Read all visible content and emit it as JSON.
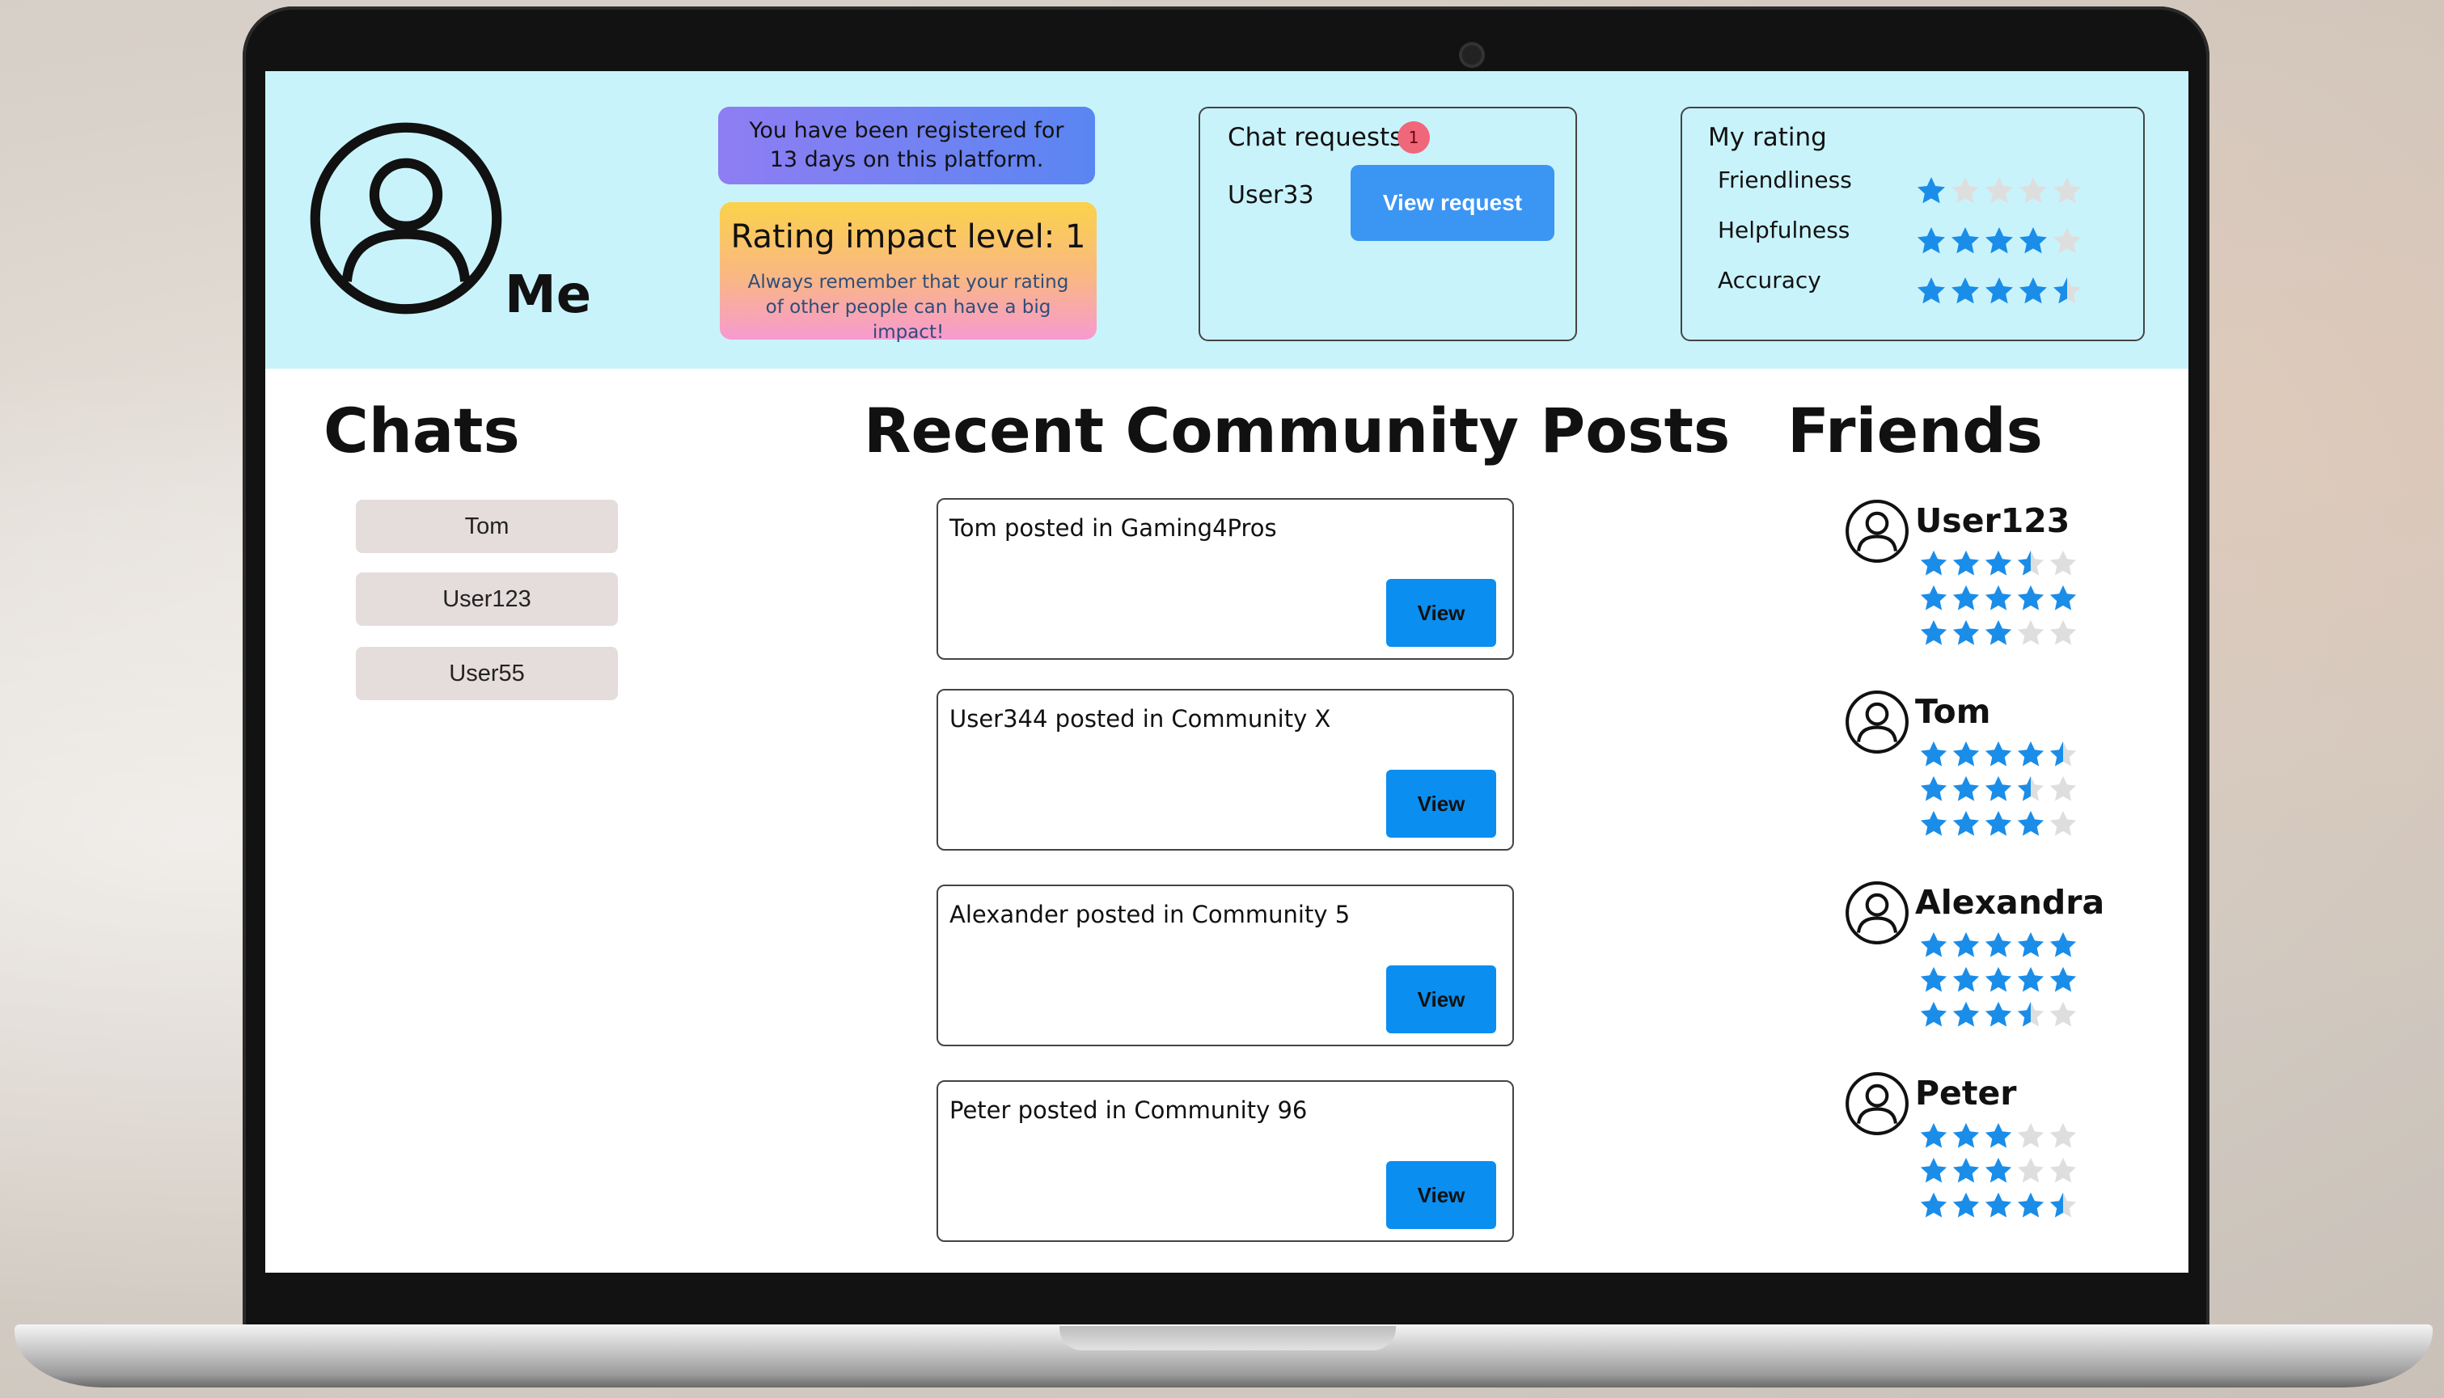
{
  "header": {
    "me_label": "Me",
    "registration_text": "You have been registered for 13 days on this platform.",
    "impact_title": "Rating impact level: 1",
    "impact_subtitle": "Always remember that your rating of other people can have a big impact!",
    "chat_requests": {
      "title": "Chat requests",
      "badge_count": "1",
      "user": "User33",
      "button_label": "View request"
    },
    "my_rating": {
      "title": "My rating",
      "rows": [
        {
          "label": "Friendliness",
          "stars": 1
        },
        {
          "label": "Helpfulness",
          "stars": 4
        },
        {
          "label": "Accuracy",
          "stars": 4.5
        }
      ]
    }
  },
  "chats": {
    "title": "Chats",
    "items": [
      "Tom",
      "User123",
      "User55"
    ]
  },
  "posts": {
    "title": "Recent Community Posts",
    "button_label": "View",
    "items": [
      "Tom posted in Gaming4Pros",
      "User344 posted in Community X",
      "Alexander  posted in Community 5",
      "Peter posted in Community 96"
    ]
  },
  "friends": {
    "title": "Friends",
    "items": [
      {
        "name": "User123",
        "ratings": [
          3.5,
          5,
          3
        ]
      },
      {
        "name": "Tom",
        "ratings": [
          4.5,
          3.5,
          4
        ]
      },
      {
        "name": "Alexandra",
        "ratings": [
          5,
          5,
          3.5
        ]
      },
      {
        "name": "Peter",
        "ratings": [
          3,
          3,
          4.5
        ]
      }
    ]
  },
  "colors": {
    "header_bg": "#c9f3fb",
    "star_filled": "#1a8de9",
    "star_empty": "#dedede",
    "view_button": "#0a8ef0",
    "view_request_button": "#3b95f3",
    "badge": "#f0677a"
  }
}
